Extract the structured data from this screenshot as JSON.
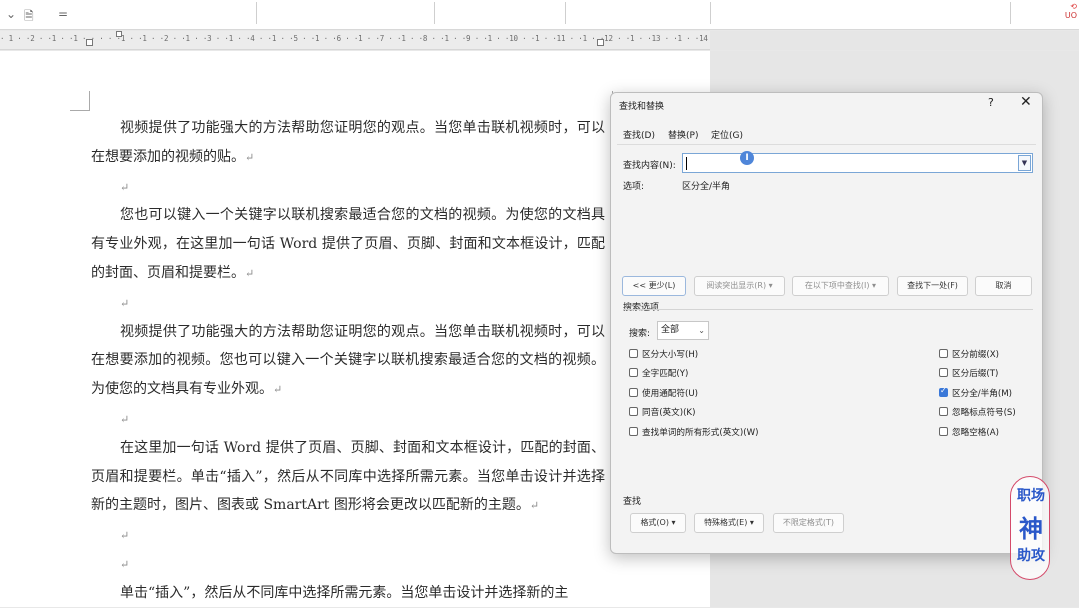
{
  "toolbar": {
    "icons": [
      "print-preview-icon",
      "customize-dropdown-icon"
    ],
    "right_text": "UO"
  },
  "ruler": {
    "text": "· 1 · ·2 · ·1 · ·1 · · ·  · ·1 · ·1 · ·2 · ·1 · ·3 · ·1 · ·4 · ·1 · ·5 · ·1 · ·6 · ·1 · ·7 · ·1 · ·8 · ·1 · ·9 · ·1 · ·10 · ·1 · ·11 · ·1 · ·12 · ·1 · ·13 · ·1 · ·14 · ·1 · ·15 · ·1 · ·16 · ·1 · ·17 · ·1 ·"
  },
  "document": {
    "paragraphs": [
      "视频提供了功能强大的方法帮助您证明您的观点。当您单击联机视频时，可以在想要添加的视频的贴。",
      "",
      "您也可以键入一个关键字以联机搜索最适合您的文档的视频。为使您的文档具有专业外观，在这里加一句话 Word 提供了页眉、页脚、封面和文本框设计，匹配的封面、页眉和提要栏。",
      "",
      "视频提供了功能强大的方法帮助您证明您的观点。当您单击联机视频时，可以在想要添加的视频。您也可以键入一个关键字以联机搜索最适合您的文档的视频。为使您的文档具有专业外观。",
      "",
      "在这里加一句话 Word 提供了页眉、页脚、封面和文本框设计，匹配的封面、页眉和提要栏。单击“插入”，然后从不同库中选择所需元素。当您单击设计并选择新的主题时，图片、图表或 SmartArt 图形将会更改以匹配新的主题。",
      "",
      "",
      "单击“插入”，然后从不同库中选择所需元素。当您单击设计并选择新的主"
    ],
    "para_mark": "↵"
  },
  "dialog": {
    "title": "查找和替换",
    "help": "?",
    "close": "✕",
    "tabs": [
      "查找(D)",
      "替换(P)",
      "定位(G)"
    ],
    "find_label": "查找内容(N):",
    "find_value": "",
    "options_label": "选项:",
    "options_value": "区分全/半角",
    "buttons": {
      "less": "<< 更少(L)",
      "reading_highlight": "阅读突出显示(R) ▾",
      "find_in": "在以下项中查找(I) ▾",
      "find_next": "查找下一处(F)",
      "cancel": "取消"
    },
    "search_options_title": "搜索选项",
    "search_label": "搜索:",
    "search_value": "全部",
    "left_checks": [
      {
        "label": "区分大小写(H)",
        "checked": false
      },
      {
        "label": "全字匹配(Y)",
        "checked": false
      },
      {
        "label": "使用通配符(U)",
        "checked": false
      },
      {
        "label": "同音(英文)(K)",
        "checked": false
      },
      {
        "label": "查找单词的所有形式(英文)(W)",
        "checked": false
      }
    ],
    "right_checks": [
      {
        "label": "区分前缀(X)",
        "checked": false
      },
      {
        "label": "区分后缀(T)",
        "checked": false
      },
      {
        "label": "区分全/半角(M)",
        "checked": true
      },
      {
        "label": "忽略标点符号(S)",
        "checked": false
      },
      {
        "label": "忽略空格(A)",
        "checked": false
      }
    ],
    "find_section": "查找",
    "bottom_buttons": {
      "format": "格式(O) ▾",
      "special": "特殊格式(E) ▾",
      "no_format": "不限定格式(T)"
    }
  },
  "watermark": {
    "line1": "职场",
    "line2": "神",
    "line3": "助攻"
  },
  "colors": {
    "accent": "#3b78d8",
    "watermark_border": "#d44a6a",
    "watermark_text": "#2a58c9"
  }
}
